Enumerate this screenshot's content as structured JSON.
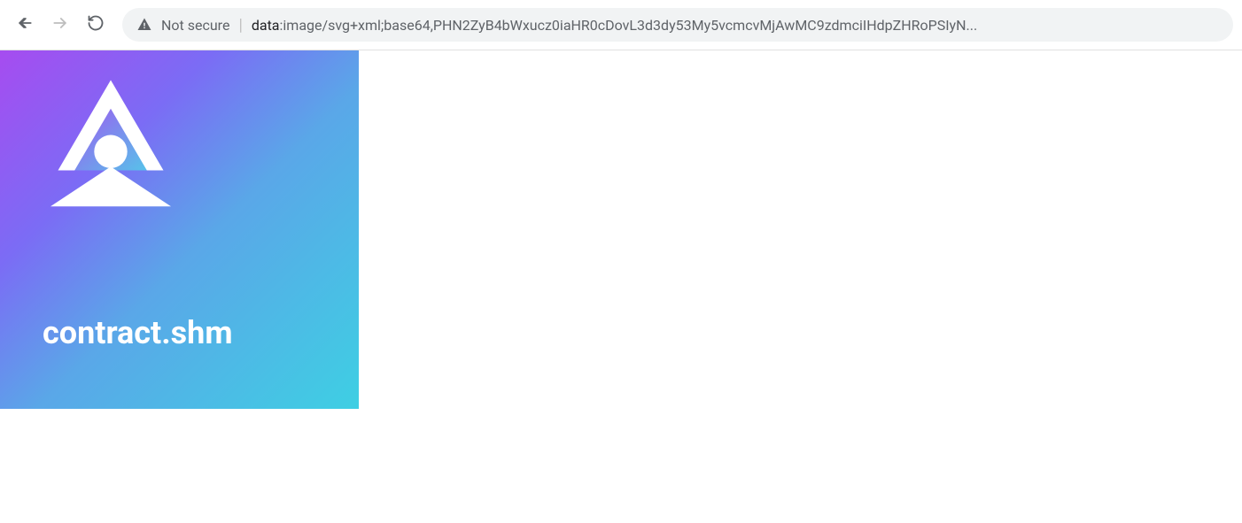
{
  "toolbar": {
    "not_secure_label": "Not secure",
    "url_scheme": "data",
    "url_rest": ":image/svg+xml;base64,PHN2ZyB4bWxucz0iaHR0cDovL3d3dy53My5vcmcvMjAwMC9zdmciIHdpZHRoPSIyN..."
  },
  "tile": {
    "label": "contract.shm",
    "gradient_from": "#a64cf0",
    "gradient_to": "#3ecfe3"
  }
}
